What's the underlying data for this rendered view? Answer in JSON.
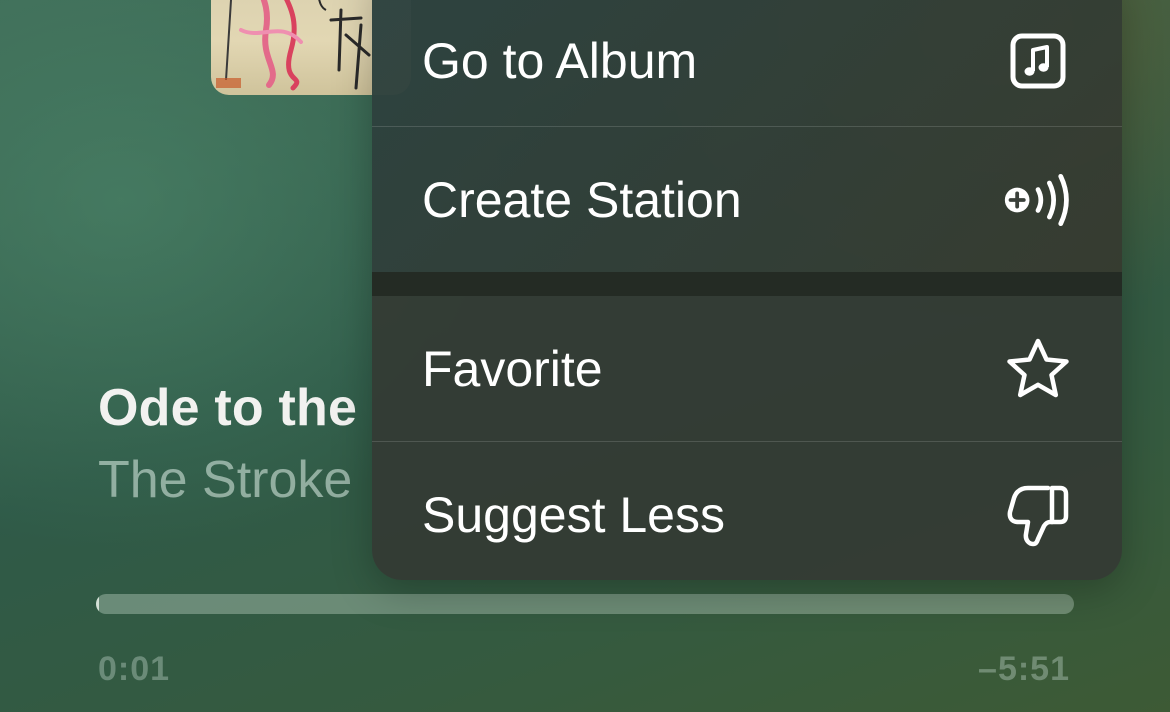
{
  "now_playing": {
    "title": "Ode to the",
    "artist": "The Stroke",
    "progress": 0.003,
    "elapsed": "0:01",
    "remaining": "–5:51"
  },
  "context_menu": {
    "items": [
      {
        "label": "Go to Album",
        "icon": "album-music-note-icon"
      },
      {
        "label": "Create Station",
        "icon": "station-broadcast-icon"
      },
      {
        "label": "Favorite",
        "icon": "star-icon"
      },
      {
        "label": "Suggest Less",
        "icon": "thumbs-down-icon"
      }
    ]
  }
}
